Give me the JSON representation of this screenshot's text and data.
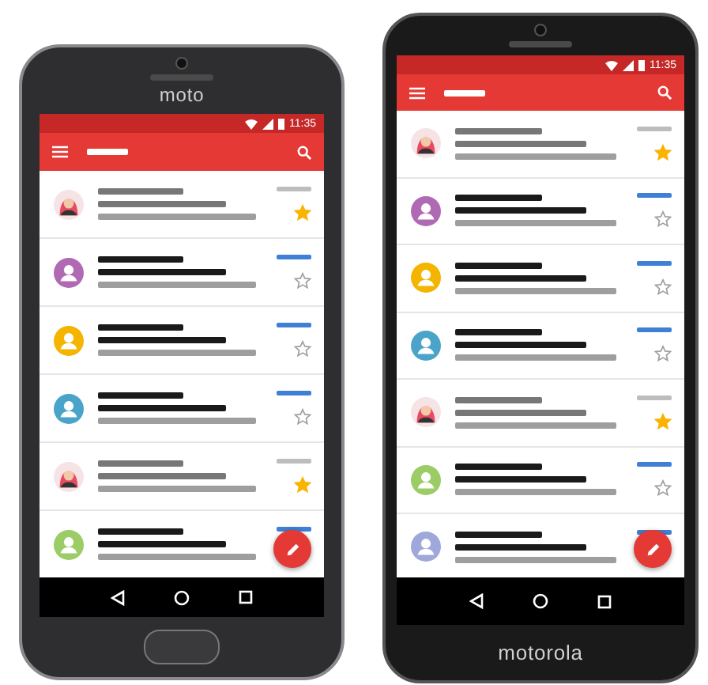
{
  "phones": [
    {
      "kind": "compact",
      "brand": "moto",
      "time": "11:35",
      "rows": [
        {
          "kind": "figure",
          "unread": false,
          "starred": true,
          "labeled": false
        },
        {
          "kind": "icon",
          "color": "#b06ab3",
          "unread": true,
          "starred": false,
          "labeled": true
        },
        {
          "kind": "icon",
          "color": "#f4b400",
          "unread": true,
          "starred": false,
          "labeled": true
        },
        {
          "kind": "icon",
          "color": "#4aa3c8",
          "unread": true,
          "starred": false,
          "labeled": true
        },
        {
          "kind": "figure",
          "unread": false,
          "starred": true,
          "labeled": false
        },
        {
          "kind": "icon",
          "color": "#9ccc65",
          "unread": true,
          "labeled": true
        }
      ]
    },
    {
      "kind": "tall",
      "brand": "motorola",
      "time": "11:35",
      "rows": [
        {
          "kind": "figure",
          "unread": false,
          "starred": true,
          "labeled": false
        },
        {
          "kind": "icon",
          "color": "#b06ab3",
          "unread": true,
          "starred": false,
          "labeled": true
        },
        {
          "kind": "icon",
          "color": "#f4b400",
          "unread": true,
          "starred": false,
          "labeled": true
        },
        {
          "kind": "icon",
          "color": "#4aa3c8",
          "unread": true,
          "starred": false,
          "labeled": true
        },
        {
          "kind": "figure",
          "unread": false,
          "starred": true,
          "labeled": false
        },
        {
          "kind": "icon",
          "color": "#9ccc65",
          "unread": true,
          "starred": false,
          "labeled": true
        },
        {
          "kind": "icon",
          "color": "#9fa8da",
          "unread": true,
          "labeled": true
        }
      ]
    }
  ]
}
